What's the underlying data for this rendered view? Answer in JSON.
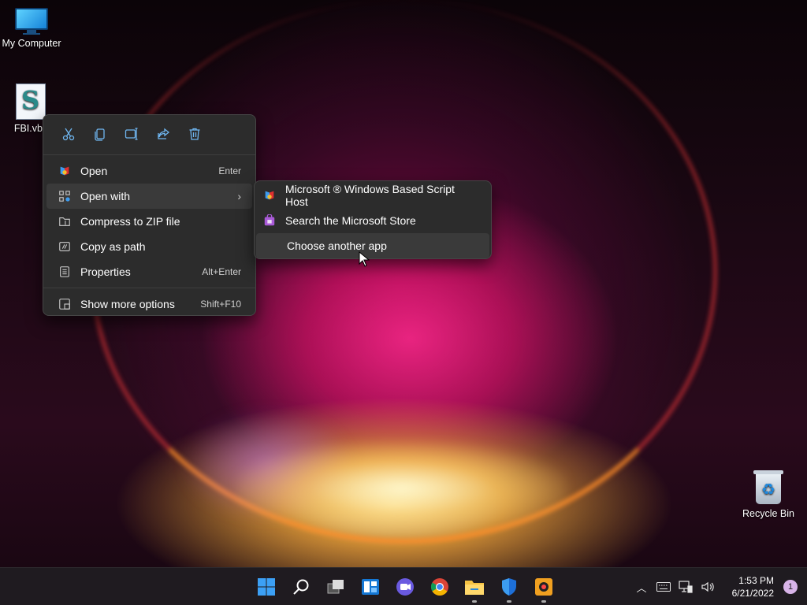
{
  "desktop": {
    "icons": [
      {
        "label": "My Computer"
      },
      {
        "label": "FBI.vbs"
      },
      {
        "label": "Recycle Bin"
      }
    ]
  },
  "context_menu": {
    "toolbar": [
      "cut",
      "copy",
      "rename",
      "share",
      "delete"
    ],
    "items": [
      {
        "label": "Open",
        "shortcut": "Enter"
      },
      {
        "label": "Open with",
        "shortcut": ""
      },
      {
        "label": "Compress to ZIP file",
        "shortcut": ""
      },
      {
        "label": "Copy as path",
        "shortcut": ""
      },
      {
        "label": "Properties",
        "shortcut": "Alt+Enter"
      },
      {
        "label": "Show more options",
        "shortcut": "Shift+F10"
      }
    ]
  },
  "submenu": {
    "items": [
      {
        "label": "Microsoft ® Windows Based Script Host"
      },
      {
        "label": "Search the Microsoft Store"
      },
      {
        "label": "Choose another app"
      }
    ]
  },
  "taskbar": {
    "apps": [
      "start",
      "search",
      "task-view",
      "widgets",
      "chat",
      "chrome",
      "file-explorer",
      "defender",
      "app"
    ],
    "clock": {
      "time": "1:53 PM",
      "date": "6/21/2022"
    },
    "notification_count": "1"
  },
  "colors": {
    "accent": "#3c9cf0",
    "menu_bg": "#2c2c2c"
  }
}
